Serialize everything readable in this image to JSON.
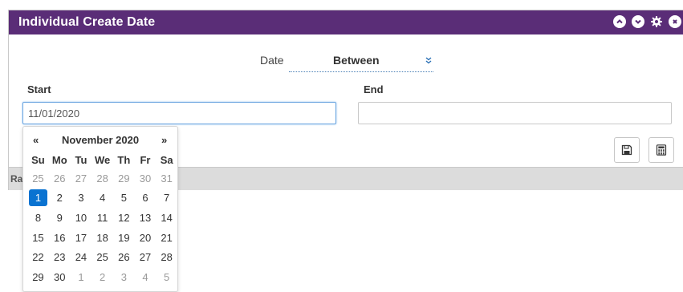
{
  "panel": {
    "title": "Individual Create Date",
    "accent": "#5a2d77",
    "header_icons": [
      "chevron-up-icon",
      "chevron-down-icon",
      "gear-icon",
      "close-icon"
    ]
  },
  "date_field": {
    "label": "Date",
    "mode": "Between"
  },
  "start": {
    "label": "Start",
    "value": "11/01/2020"
  },
  "end": {
    "label": "End",
    "value": "",
    "placeholder": ""
  },
  "toolbar": {
    "save_icon": "save-icon",
    "calc_icon": "calculator-icon"
  },
  "footer": {
    "text": "Ra"
  },
  "datepicker": {
    "prev": "«",
    "next": "»",
    "month_label": "November 2020",
    "weekdays": [
      "Su",
      "Mo",
      "Tu",
      "We",
      "Th",
      "Fr",
      "Sa"
    ],
    "weeks": [
      [
        "25",
        "26",
        "27",
        "28",
        "29",
        "30",
        "31"
      ],
      [
        "1",
        "2",
        "3",
        "4",
        "5",
        "6",
        "7"
      ],
      [
        "8",
        "9",
        "10",
        "11",
        "12",
        "13",
        "14"
      ],
      [
        "15",
        "16",
        "17",
        "18",
        "19",
        "20",
        "21"
      ],
      [
        "22",
        "23",
        "24",
        "25",
        "26",
        "27",
        "28"
      ],
      [
        "29",
        "30",
        "1",
        "2",
        "3",
        "4",
        "5"
      ]
    ],
    "selected": "1",
    "selected_color": "#0a73d1"
  }
}
